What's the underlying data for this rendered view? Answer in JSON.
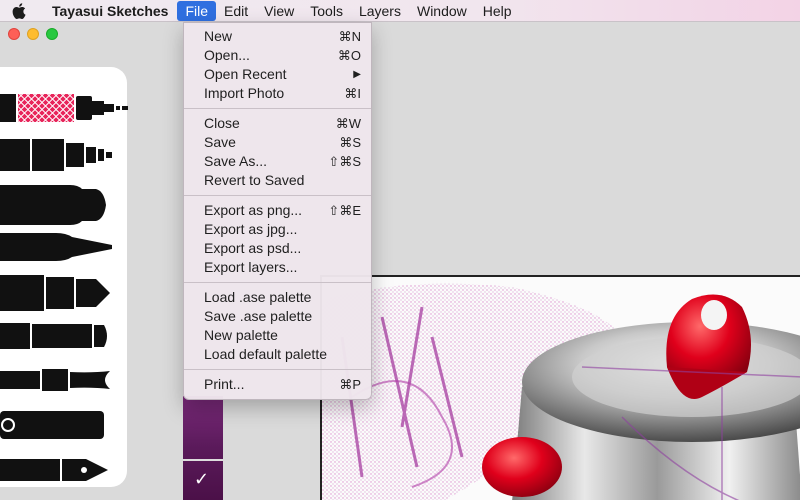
{
  "menubar": {
    "app_name": "Tayasui Sketches",
    "items": [
      "File",
      "Edit",
      "View",
      "Tools",
      "Layers",
      "Window",
      "Help"
    ]
  },
  "file_menu": {
    "groups": [
      [
        {
          "label": "New",
          "shortcut": "⌘N"
        },
        {
          "label": "Open...",
          "shortcut": "⌘O"
        },
        {
          "label": "Open Recent",
          "shortcut": "▶"
        },
        {
          "label": "Import Photo",
          "shortcut": "⌘I"
        }
      ],
      [
        {
          "label": "Close",
          "shortcut": "⌘W"
        },
        {
          "label": "Save",
          "shortcut": "⌘S"
        },
        {
          "label": "Save As...",
          "shortcut": "⇧⌘S"
        },
        {
          "label": "Revert to Saved",
          "shortcut": ""
        }
      ],
      [
        {
          "label": "Export as png...",
          "shortcut": "⇧⌘E"
        },
        {
          "label": "Export as jpg...",
          "shortcut": ""
        },
        {
          "label": "Export as psd...",
          "shortcut": ""
        },
        {
          "label": "Export layers...",
          "shortcut": ""
        }
      ],
      [
        {
          "label": "Load .ase palette",
          "shortcut": ""
        },
        {
          "label": "Save .ase palette",
          "shortcut": ""
        },
        {
          "label": "New palette",
          "shortcut": ""
        },
        {
          "label": "Load default palette",
          "shortcut": ""
        }
      ],
      [
        {
          "label": "Print...",
          "shortcut": "⌘P"
        }
      ]
    ]
  },
  "colors": {
    "menu_highlight": "#2f6fe0",
    "selected_color": "#5a1a5a",
    "brush_accent": "#e8245a",
    "paint_red": "#e0001b",
    "sketch_pink": "#d070c0"
  },
  "icons": {
    "apple": "apple-logo-icon",
    "check": "checkmark-icon"
  }
}
